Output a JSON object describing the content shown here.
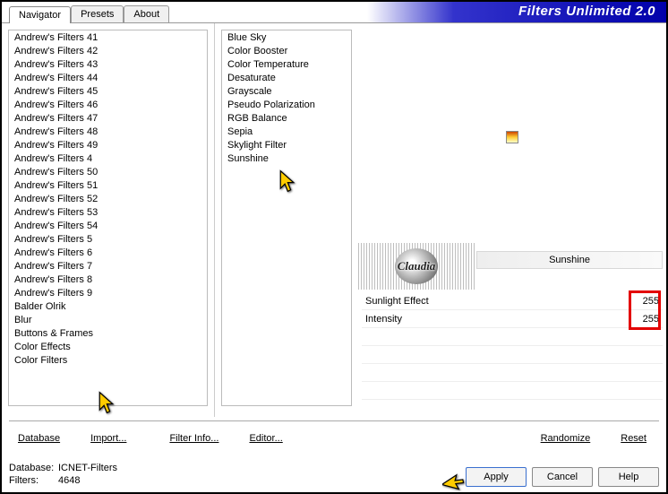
{
  "app_title": "Filters Unlimited 2.0",
  "tabs": [
    "Navigator",
    "Presets",
    "About"
  ],
  "active_tab": 0,
  "categories": [
    "Andrew's Filters 41",
    "Andrew's Filters 42",
    "Andrew's Filters 43",
    "Andrew's Filters 44",
    "Andrew's Filters 45",
    "Andrew's Filters 46",
    "Andrew's Filters 47",
    "Andrew's Filters 48",
    "Andrew's Filters 49",
    "Andrew's Filters 4",
    "Andrew's Filters 50",
    "Andrew's Filters 51",
    "Andrew's Filters 52",
    "Andrew's Filters 53",
    "Andrew's Filters 54",
    "Andrew's Filters 5",
    "Andrew's Filters 6",
    "Andrew's Filters 7",
    "Andrew's Filters 8",
    "Andrew's Filters 9",
    "Balder Olrik",
    "Blur",
    "Buttons & Frames",
    "Color Effects",
    "Color Filters"
  ],
  "filters": [
    "Blue Sky",
    "Color Booster",
    "Color Temperature",
    "Desaturate",
    "Grayscale",
    "Pseudo Polarization",
    "RGB Balance",
    "Sepia",
    "Skylight Filter",
    "Sunshine"
  ],
  "selected_filter": "Sunshine",
  "watermark_text": "Claudia",
  "params": [
    {
      "label": "Sunlight Effect",
      "value": "255"
    },
    {
      "label": "Intensity",
      "value": "255"
    }
  ],
  "toolbar": {
    "database": "Database",
    "import": "Import...",
    "filter_info": "Filter Info...",
    "editor": "Editor...",
    "randomize": "Randomize",
    "reset": "Reset"
  },
  "actions": {
    "apply": "Apply",
    "cancel": "Cancel",
    "help": "Help"
  },
  "status": {
    "db_label": "Database:",
    "db_value": "ICNET-Filters",
    "filters_label": "Filters:",
    "filters_value": "4648"
  }
}
